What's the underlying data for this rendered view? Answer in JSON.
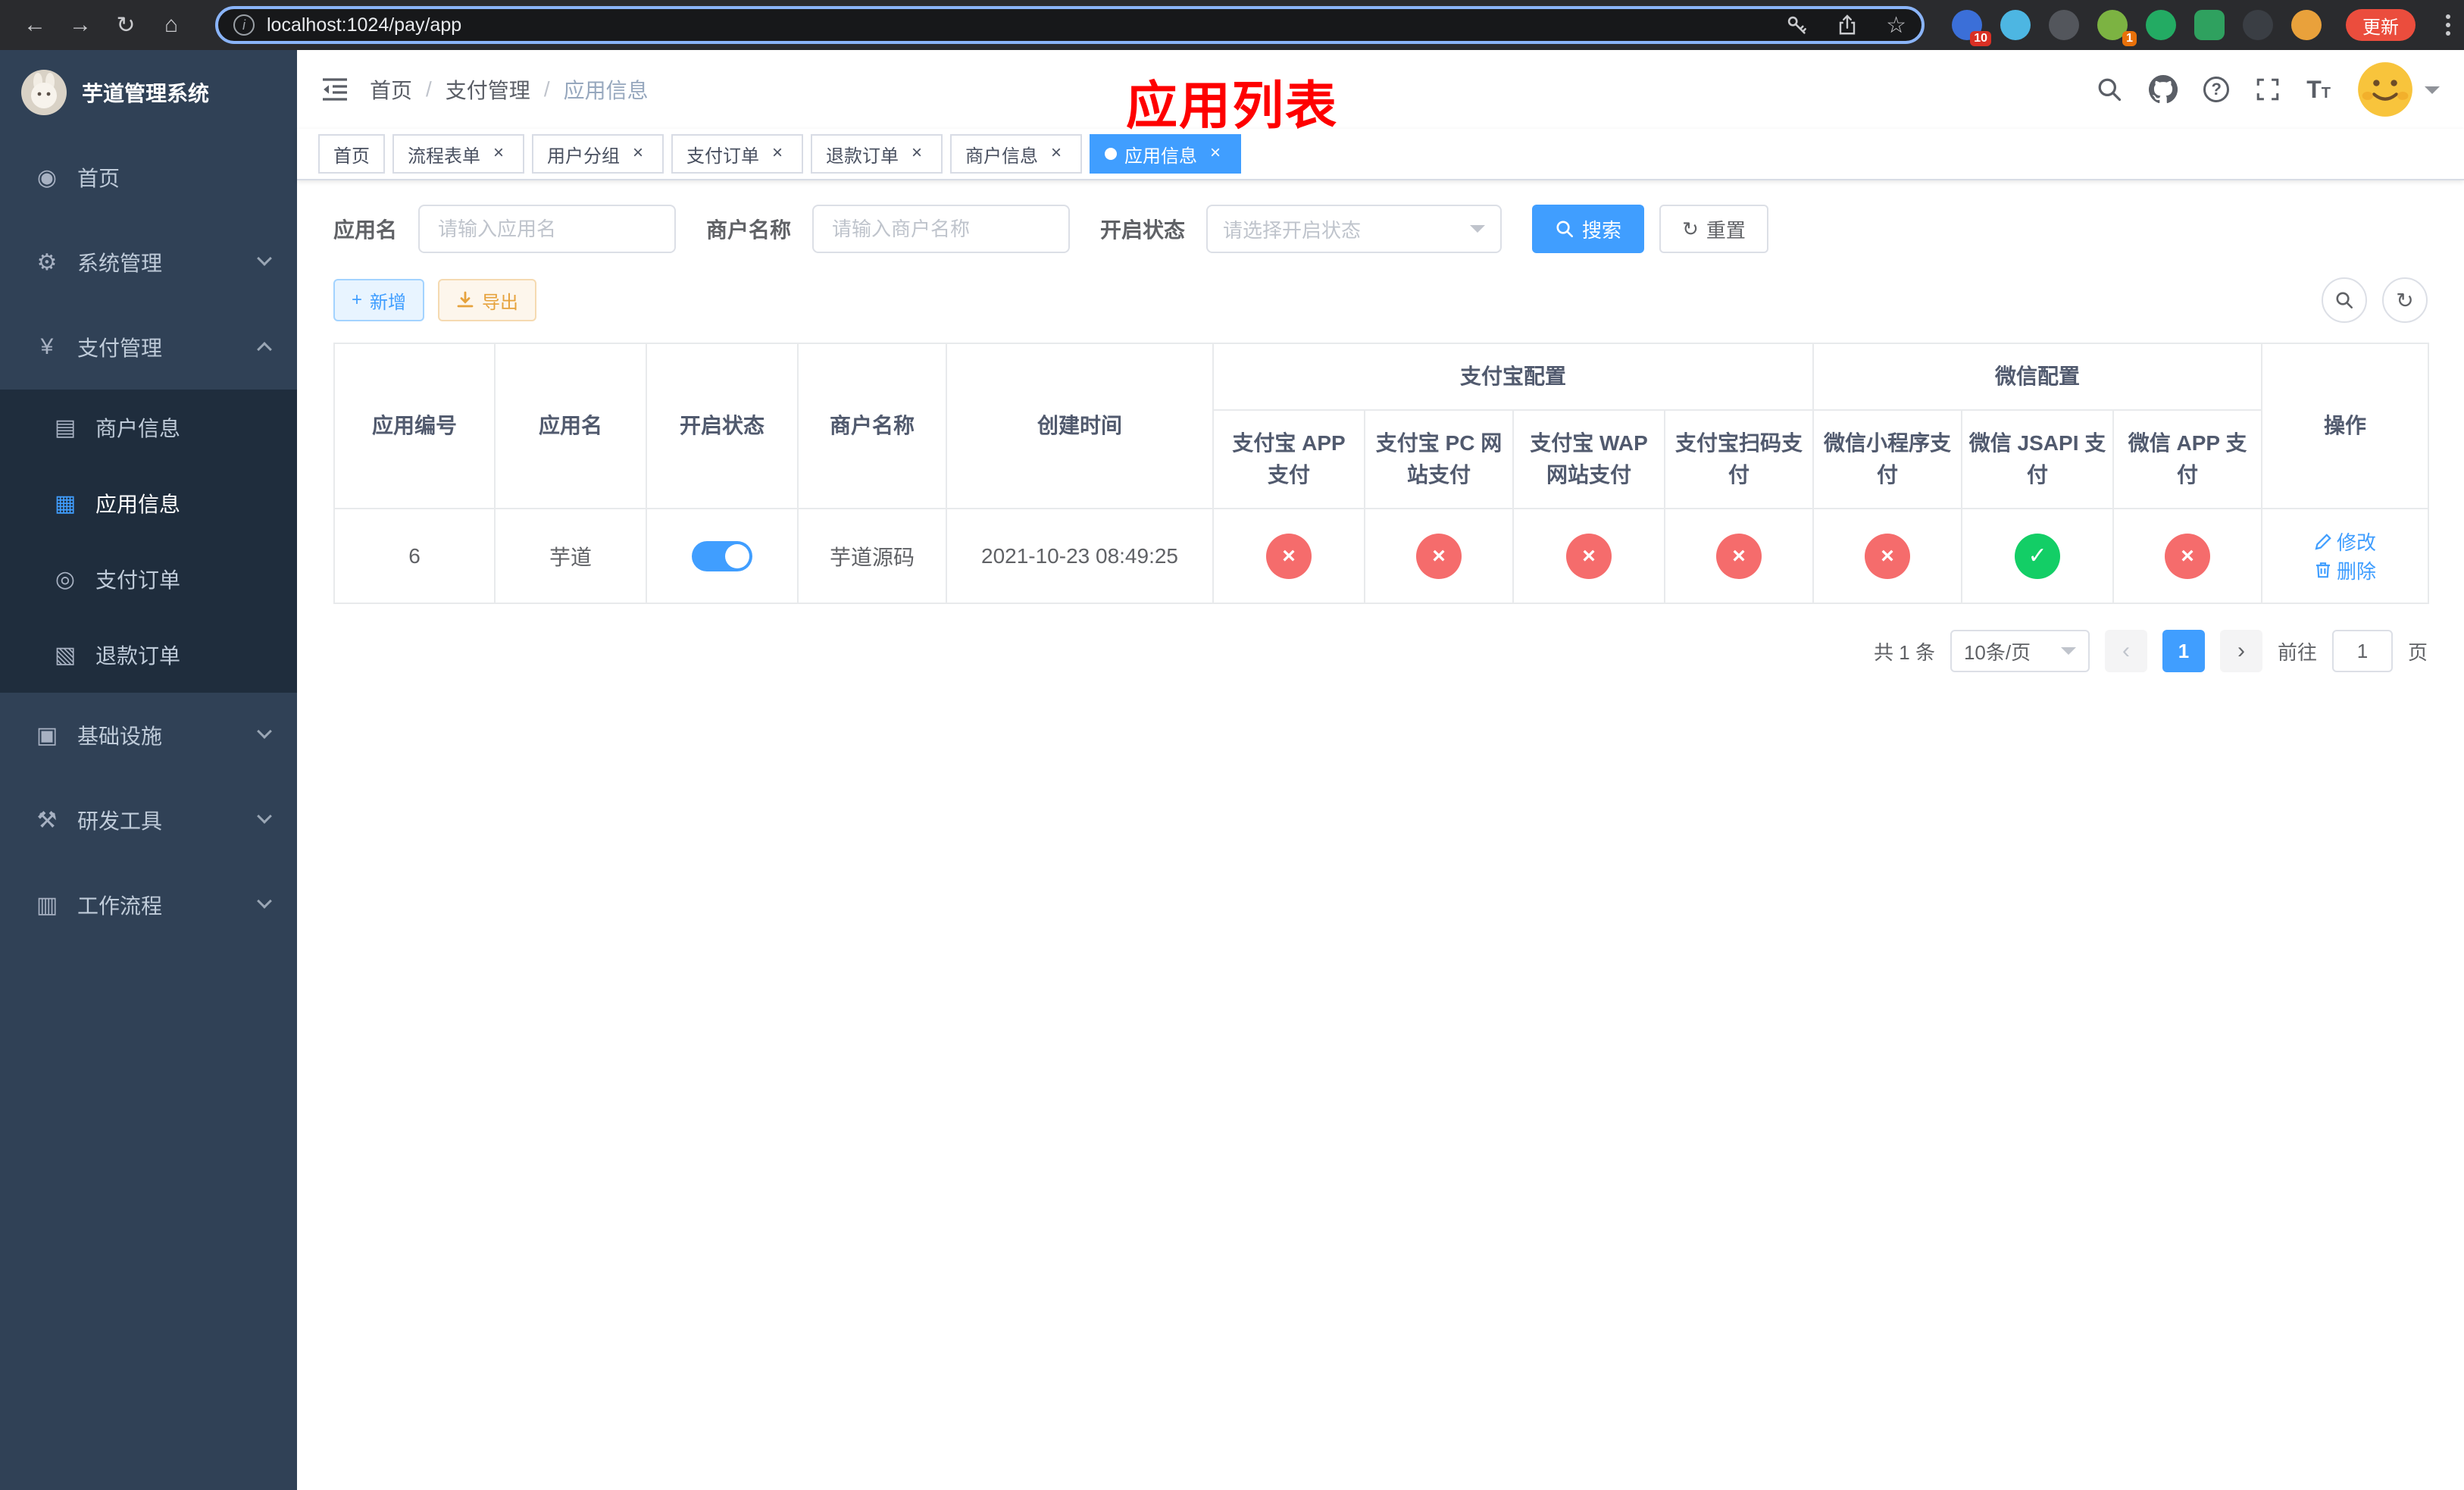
{
  "colors": {
    "primary": "#409EFF",
    "danger": "#f56c6c",
    "success": "#13ce66",
    "warning": "#e6a23c",
    "sidebar_bg": "#304156",
    "submenu_bg": "#1f2d3d",
    "overlay_title_red": "#fe0000"
  },
  "browser": {
    "url": "localhost:1024/pay/app",
    "update_label": "更新",
    "extensions": [
      {
        "name": "extension-1",
        "color": "#3b6fd8",
        "badge": "10"
      },
      {
        "name": "extension-2",
        "color": "#4db6e2",
        "badge": ""
      },
      {
        "name": "extension-3",
        "color": "#53565c",
        "badge": ""
      },
      {
        "name": "extension-4",
        "color": "#7cb342",
        "badge": "1"
      },
      {
        "name": "extension-5",
        "color": "#23ab63",
        "badge": ""
      },
      {
        "name": "extension-6",
        "color": "#2fa15f",
        "badge": ""
      },
      {
        "name": "extension-7",
        "color": "#3a3e44",
        "badge": ""
      },
      {
        "name": "extension-8",
        "color": "#e9a13b",
        "badge": ""
      }
    ]
  },
  "icons": {
    "back": "←",
    "forward": "→",
    "reload": "↻",
    "browser_home": "⌂",
    "star": "☆",
    "home": "◉",
    "system": "⚙",
    "pay": "¥",
    "merchant": "▤",
    "app": "▦",
    "order": "◎",
    "refund": "▧",
    "infra": "▣",
    "devtool": "⚒",
    "workflow": "▥",
    "plus": "+",
    "refresh": "↻",
    "close": "×",
    "check": "✓",
    "cross": "×",
    "prev": "‹",
    "next": "›",
    "font_big": "T",
    "font_small": "T",
    "help": "?",
    "info": "i"
  },
  "sidebar": {
    "title": "芋道管理系统",
    "items": [
      {
        "label": "首页"
      },
      {
        "label": "系统管理"
      },
      {
        "label": "支付管理",
        "children": [
          {
            "label": "商户信息"
          },
          {
            "label": "应用信息"
          },
          {
            "label": "支付订单"
          },
          {
            "label": "退款订单"
          }
        ]
      },
      {
        "label": "基础设施"
      },
      {
        "label": "研发工具"
      },
      {
        "label": "工作流程"
      }
    ]
  },
  "header": {
    "breadcrumb": [
      "首页",
      "支付管理",
      "应用信息"
    ],
    "overlay_title": "应用列表"
  },
  "tabs": [
    {
      "label": "首页",
      "closable": false,
      "active": false
    },
    {
      "label": "流程表单",
      "closable": true,
      "active": false
    },
    {
      "label": "用户分组",
      "closable": true,
      "active": false
    },
    {
      "label": "支付订单",
      "closable": true,
      "active": false
    },
    {
      "label": "退款订单",
      "closable": true,
      "active": false
    },
    {
      "label": "商户信息",
      "closable": true,
      "active": false
    },
    {
      "label": "应用信息",
      "closable": true,
      "active": true
    }
  ],
  "filters": {
    "app_name_label": "应用名",
    "app_name_placeholder": "请输入应用名",
    "merchant_label": "商户名称",
    "merchant_placeholder": "请输入商户名称",
    "status_label": "开启状态",
    "status_placeholder": "请选择开启状态",
    "search_button": "搜索",
    "reset_button": "重置"
  },
  "toolbar": {
    "add_button": "新增",
    "export_button": "导出"
  },
  "table": {
    "groups": {
      "alipay": "支付宝配置",
      "wechat": "微信配置"
    },
    "columns": [
      "应用编号",
      "应用名",
      "开启状态",
      "商户名称",
      "创建时间",
      "支付宝 APP 支付",
      "支付宝 PC 网站支付",
      "支付宝 WAP 网站支付",
      "支付宝扫码支付",
      "微信小程序支付",
      "微信 JSAPI 支付",
      "微信 APP 支付",
      "操作"
    ],
    "rows": [
      {
        "id": "6",
        "app_name": "芋道",
        "status_on": true,
        "merchant": "芋道源码",
        "created": "2021-10-23 08:49:25",
        "configs": [
          "no",
          "no",
          "no",
          "no",
          "no",
          "yes",
          "no"
        ],
        "edit_label": "修改",
        "delete_label": "删除"
      }
    ]
  },
  "pagination": {
    "total": "共 1 条",
    "page_size": "10条/页",
    "current_page": "1",
    "goto_label": "前往",
    "goto_value": "1",
    "goto_suffix": "页"
  }
}
